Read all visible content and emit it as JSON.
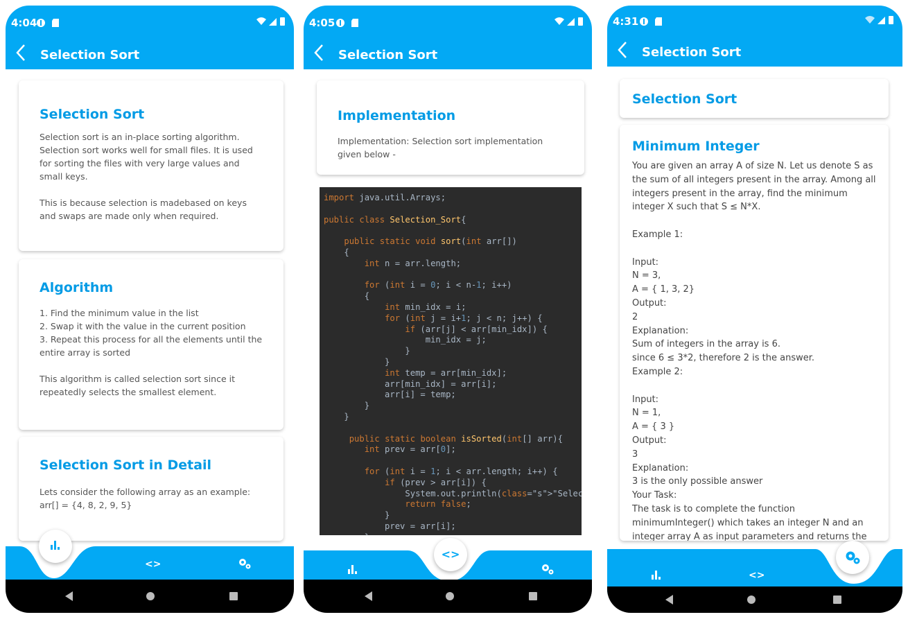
{
  "colors": {
    "accent": "#03a9f4",
    "title": "#039be5",
    "code_bg": "#2b2b2b"
  },
  "phones": [
    {
      "status": {
        "time": "4:04"
      },
      "appbar": {
        "title": "Selection Sort"
      },
      "cards": [
        {
          "title": "Selection Sort",
          "text": "Selection sort is an in-place sorting algorithm. Selection sort works well for small files. It is used for sorting the files with very large values and small keys.\n\nThis is because selection is madebased on keys and swaps are made only when required."
        },
        {
          "title": "Algorithm",
          "text": "1. Find the minimum value in the list\n2. Swap it with the value in the current position\n3. Repeat this process for all the elements until the entire array is sorted\n\nThis algorithm is called selection sort since it repeatedly selects the smallest element."
        },
        {
          "title": "Selection Sort in Detail",
          "text": "Lets consider the following array as an example:\narr[] = {4, 8, 2, 9, 5}"
        }
      ],
      "active_tab": "stats"
    },
    {
      "status": {
        "time": "4:05"
      },
      "appbar": {
        "title": "Selection Sort"
      },
      "cards": [
        {
          "title": "Implementation",
          "text": "Implementation: Selection sort implementation given below -"
        }
      ],
      "active_tab": "code"
    },
    {
      "status": {
        "time": "4:31"
      },
      "appbar": {
        "title": "Selection Sort"
      },
      "cards": [
        {
          "title": "Selection Sort",
          "text": ""
        },
        {
          "title": "Minimum Integer",
          "text": "You are given an array A of size N. Let us denote S as the sum of all integers present in the array. Among all integers present in the array, find the minimum integer X such that S ≤ N*X.\n\nExample 1:\n\nInput:\nN = 3,\nA = { 1, 3, 2}\nOutput:\n2\nExplanation:\nSum of integers in the array is 6.\nsince 6 ≤ 3*2, therefore 2 is the answer.\nExample 2:\n\nInput:\nN = 1,\nA = { 3 }\nOutput:\n3\nExplanation:\n3 is the only possible answer\nYour Task:\nThe task is to complete the function minimumInteger() which takes an integer N and an integer array A as input parameters and returns the"
        }
      ],
      "active_tab": "settings"
    }
  ],
  "code_lines": [
    "import java.util.Arrays;",
    "",
    "public class Selection_Sort{",
    "",
    "    public static void sort(int arr[])",
    "    {",
    "        int n = arr.length;",
    "",
    "        for (int i = 0; i < n-1; i++)",
    "        {",
    "            int min_idx = i;",
    "            for (int j = i+1; j < n; j++) {",
    "                if (arr[j] < arr[min_idx]) {",
    "                    min_idx = j;",
    "                }",
    "            }",
    "            int temp = arr[min_idx];",
    "            arr[min_idx] = arr[i];",
    "            arr[i] = temp;",
    "        }",
    "    }",
    "",
    "     public static boolean isSorted(int[] arr){",
    "        int prev = arr[0];",
    "",
    "        for (int i = 1; i < arr.length; i++) {",
    "            if (prev > arr[i]) {",
    "                System.out.println(\"Selection Sort failed\");",
    "                return false;",
    "            }",
    "            prev = arr[i];",
    "        }"
  ],
  "nav": {
    "stats_icon": "bar-chart-icon",
    "code_icon": "code-icon",
    "code_glyph": "<>",
    "settings_icon": "gears-icon"
  }
}
